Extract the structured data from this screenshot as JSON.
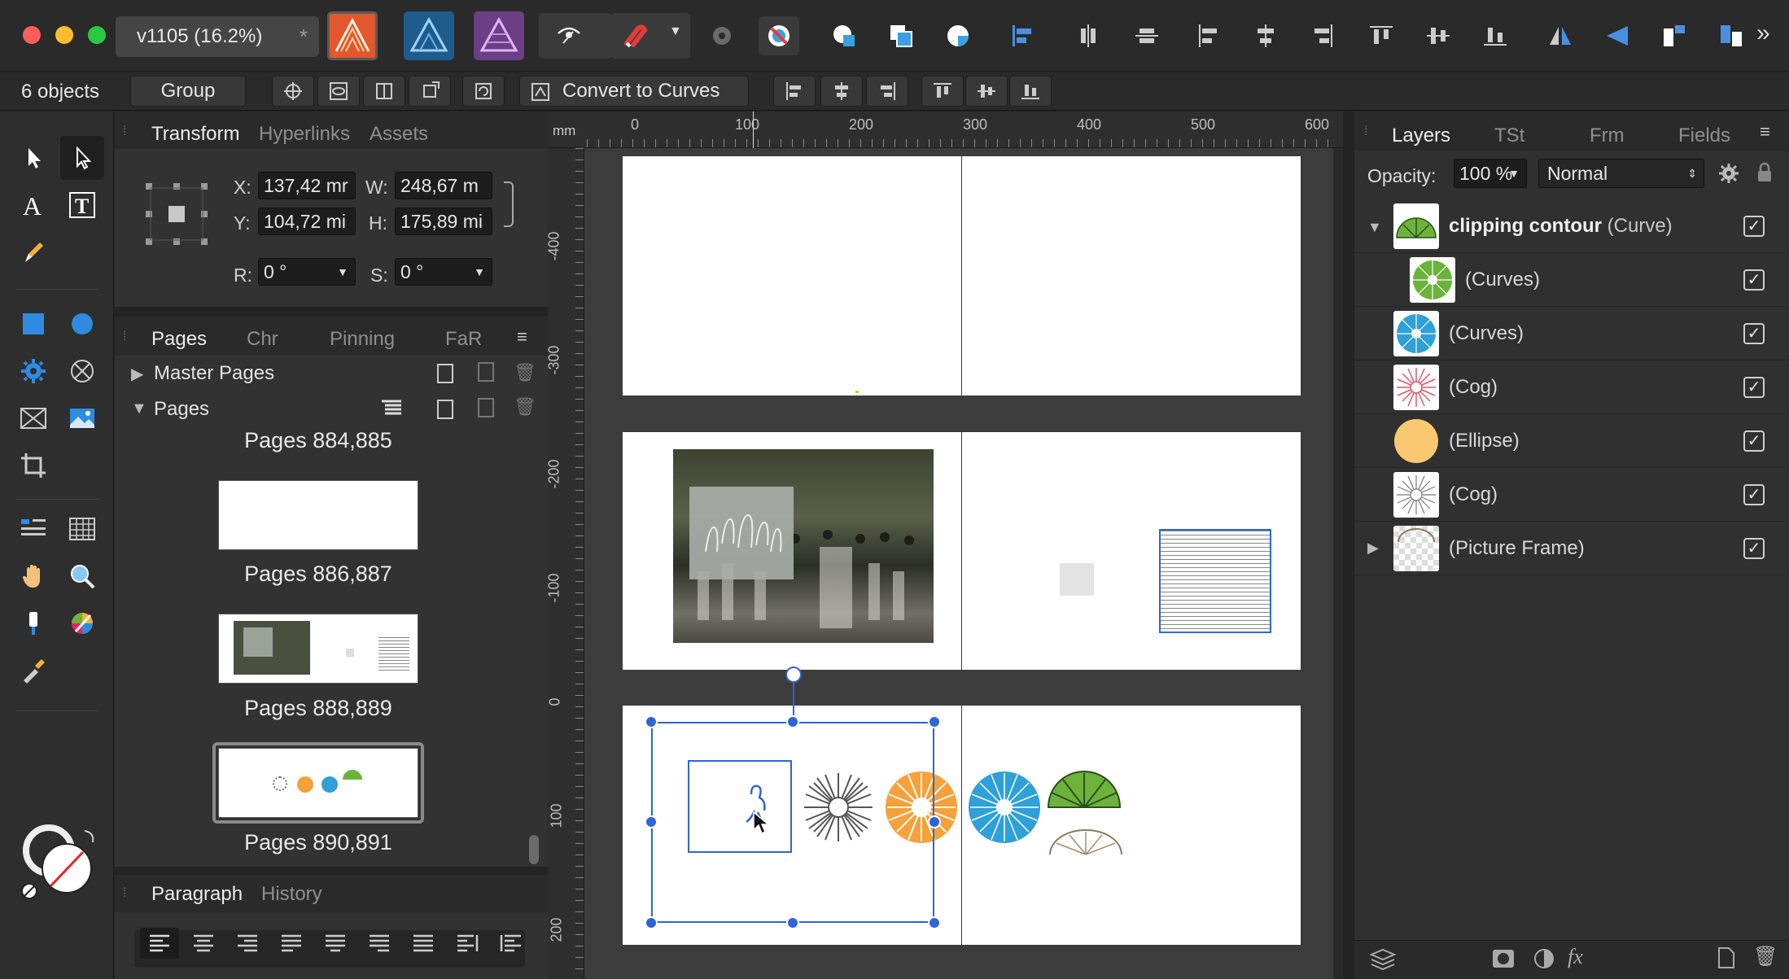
{
  "window": {
    "document_tab": "v1105  (16.2%)",
    "modified_mark": "*"
  },
  "context_toolbar": {
    "selection_count": "6 objects",
    "group_label": "Group",
    "convert_label": "Convert to Curves"
  },
  "transform_panel": {
    "tabs": [
      "Transform",
      "Hyperlinks",
      "Assets"
    ],
    "x_label": "X:",
    "x_value": "137,42 mr",
    "y_label": "Y:",
    "y_value": "104,72 mi",
    "w_label": "W:",
    "w_value": "248,67 m",
    "h_label": "H:",
    "h_value": "175,89 mi",
    "r_label": "R:",
    "r_value": "0 °",
    "s_label": "S:",
    "s_value": "0 °"
  },
  "pages_panel": {
    "tabs": [
      "Pages",
      "Chr",
      "Pinning",
      "FaR"
    ],
    "master_pages_label": "Master Pages",
    "pages_label": "Pages",
    "spreads": [
      "Pages 884,885",
      "Pages 886,887",
      "Pages 888,889",
      "Pages 890,891"
    ]
  },
  "bottom_panel": {
    "tabs": [
      "Paragraph",
      "History"
    ]
  },
  "ruler": {
    "unit": "mm",
    "top_ticks": [
      "0",
      "100",
      "200",
      "300",
      "400",
      "500",
      "600"
    ],
    "left_ticks": [
      "-400",
      "-300",
      "-200",
      "-100",
      "0",
      "100",
      "200"
    ]
  },
  "layers_panel": {
    "tabs": [
      "Layers",
      "TSt",
      "Frm",
      "Fields"
    ],
    "opacity_label": "Opacity:",
    "opacity_value": "100 %",
    "blend_mode": "Normal",
    "layers": [
      {
        "name_bold": "clipping contour",
        "name_type": "(Curve)",
        "thumb": "green-fan",
        "expanded": true,
        "indent": false
      },
      {
        "name_bold": "",
        "name_type": "(Curves)",
        "thumb": "green-cog",
        "indent": true
      },
      {
        "name_bold": "",
        "name_type": "(Curves)",
        "thumb": "blue-cog",
        "indent": false
      },
      {
        "name_bold": "",
        "name_type": "(Cog)",
        "thumb": "red-cog",
        "indent": false
      },
      {
        "name_bold": "",
        "name_type": "(Ellipse)",
        "thumb": "orange-ellipse",
        "indent": false
      },
      {
        "name_bold": "",
        "name_type": "(Cog)",
        "thumb": "gray-cog",
        "indent": false
      },
      {
        "name_bold": "",
        "name_type": "(Picture Frame)",
        "thumb": "picture-frame",
        "expanded": false,
        "indent": false
      }
    ],
    "check_mark": "✓"
  },
  "colors": {
    "accent_blue": "#2f66d6",
    "persona_publisher": "#e2572b",
    "persona_designer": "#2a7ab4",
    "persona_photo": "#8b52a8",
    "fan_green": "#6cb33c",
    "cog_blue": "#2fa0d8",
    "ellipse_orange": "#f6a13a"
  },
  "icons": [
    "arrow-pointer-icon",
    "node-pointer-icon",
    "artistic-text-icon",
    "frame-text-icon",
    "pen-icon",
    "rectangle-icon",
    "ellipse-icon",
    "cog-icon",
    "picture-frame-icon",
    "image-icon",
    "crop-icon",
    "table-icon",
    "hand-icon",
    "zoom-icon",
    "fill-icon",
    "color-picker-icon"
  ]
}
